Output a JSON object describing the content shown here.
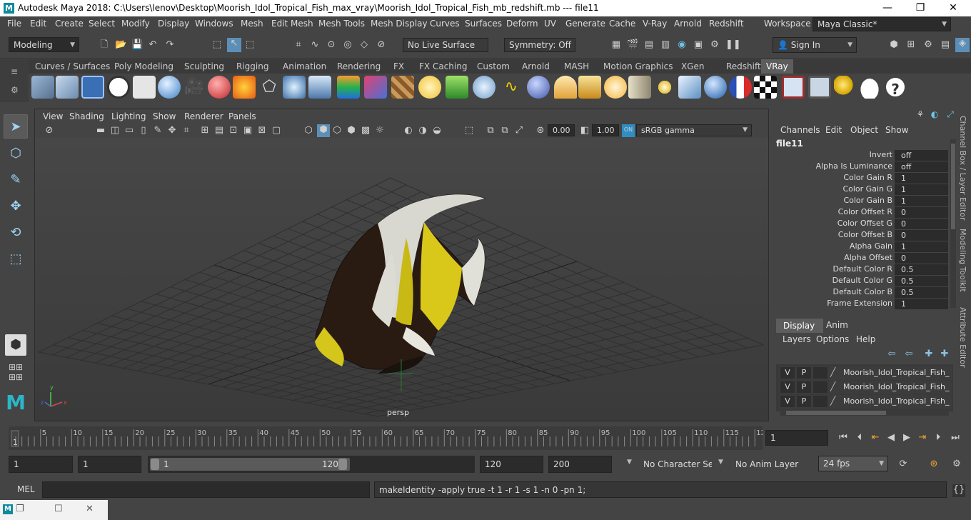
{
  "window": {
    "title": "Autodesk Maya 2018: C:\\Users\\lenov\\Desktop\\Moorish_Idol_Tropical_Fish_max_vray\\Moorish_Idol_Tropical_Fish_mb_redshift.mb  ---   file11",
    "minimize": "—",
    "maximize": "❐",
    "close": "✕"
  },
  "menubar": {
    "items": [
      "File",
      "Edit",
      "Create",
      "Select",
      "Modify",
      "Display",
      "Windows",
      "Mesh",
      "Edit Mesh",
      "Mesh Tools",
      "Mesh Display",
      "Curves",
      "Surfaces",
      "Deform",
      "UV",
      "Generate",
      "Cache",
      "V-Ray",
      "Arnold",
      "Redshift"
    ],
    "workspace_label": "Workspace :",
    "workspace_value": "Maya Classic*"
  },
  "statusline": {
    "mode": "Modeling",
    "live_surface": "No Live Surface",
    "symmetry": "Symmetry: Off",
    "sign_in": "Sign In"
  },
  "shelf": {
    "tabs": [
      "Curves / Surfaces",
      "Poly Modeling",
      "Sculpting",
      "Rigging",
      "Animation",
      "Rendering",
      "FX",
      "FX Caching",
      "Custom",
      "Arnold",
      "MASH",
      "Motion Graphics",
      "XGen",
      "Redshift",
      "VRay"
    ],
    "active_tab": "VRay"
  },
  "viewport": {
    "menus": [
      "View",
      "Shading",
      "Lighting",
      "Show",
      "Renderer",
      "Panels"
    ],
    "exposure": "0.00",
    "gamma": "1.00",
    "color_space": "sRGB gamma",
    "camera_label": "persp"
  },
  "channelbox": {
    "menus": [
      "Channels",
      "Edit",
      "Object",
      "Show"
    ],
    "node_name": "file11",
    "attributes": [
      {
        "name": "Invert",
        "value": "off"
      },
      {
        "name": "Alpha Is Luminance",
        "value": "off"
      },
      {
        "name": "Color Gain R",
        "value": "1"
      },
      {
        "name": "Color Gain G",
        "value": "1"
      },
      {
        "name": "Color Gain B",
        "value": "1"
      },
      {
        "name": "Color Offset R",
        "value": "0"
      },
      {
        "name": "Color Offset G",
        "value": "0"
      },
      {
        "name": "Color Offset B",
        "value": "0"
      },
      {
        "name": "Alpha Gain",
        "value": "1"
      },
      {
        "name": "Alpha Offset",
        "value": "0"
      },
      {
        "name": "Default Color R",
        "value": "0.5"
      },
      {
        "name": "Default Color G",
        "value": "0.5"
      },
      {
        "name": "Default Color B",
        "value": "0.5"
      },
      {
        "name": "Frame Extension",
        "value": "1"
      }
    ]
  },
  "sidetabs": [
    "Channel Box / Layer Editor",
    "Modeling Toolkit",
    "Attribute Editor"
  ],
  "layereditor": {
    "tabs": [
      "Display",
      "Anim"
    ],
    "menus": [
      "Layers",
      "Options",
      "Help"
    ],
    "layers": [
      {
        "v": "V",
        "p": "P",
        "name": "Moorish_Idol_Tropical_Fish_"
      },
      {
        "v": "V",
        "p": "P",
        "name": "Moorish_Idol_Tropical_Fish_"
      },
      {
        "v": "V",
        "p": "P",
        "name": "Moorish_Idol_Tropical_Fish_"
      }
    ]
  },
  "timeslider": {
    "ticks": [
      "5",
      "10",
      "15",
      "20",
      "25",
      "30",
      "35",
      "40",
      "45",
      "50",
      "55",
      "60",
      "65",
      "70",
      "75",
      "80",
      "85",
      "90",
      "95",
      "100",
      "105",
      "110",
      "115",
      "12"
    ],
    "current_marker": "1",
    "current_frame": "1"
  },
  "range": {
    "start": "1",
    "playback_start": "1",
    "slider_start": "1",
    "slider_end": "120",
    "playback_end": "120",
    "end": "200",
    "character_set": "No Character Set",
    "anim_layer": "No Anim Layer",
    "fps": "24 fps"
  },
  "commandline": {
    "language": "MEL",
    "result": "makeIdentity -apply true -t 1 -r 1 -s 1 -n 0 -pn 1;"
  }
}
